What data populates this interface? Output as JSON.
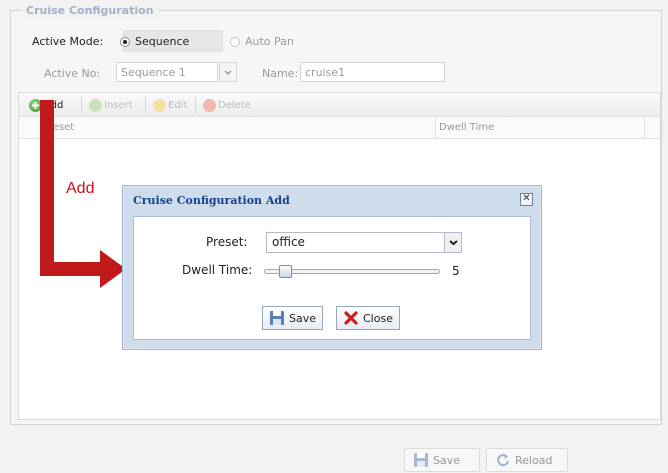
{
  "section": {
    "legend": "Cruise Configuration"
  },
  "mode": {
    "label": "Active Mode:",
    "options": [
      {
        "label": "Sequence",
        "selected": true
      },
      {
        "label": "Auto Pan",
        "selected": false
      }
    ]
  },
  "active": {
    "no_label": "Active No:",
    "no_value": "Sequence 1",
    "name_label": "Name:",
    "name_value": "cruise1"
  },
  "toolbar": {
    "add": "Add",
    "insert": "Insert",
    "edit": "Edit",
    "delete": "Delete"
  },
  "table": {
    "columns": [
      "Preset",
      "Dwell Time"
    ]
  },
  "callout": {
    "text": "Add"
  },
  "dialog": {
    "title": "Cruise Configuration Add",
    "close_symbol": "✕",
    "preset_label": "Preset:",
    "preset_value": "office",
    "dwell_label": "Dwell Time:",
    "dwell_value": "5",
    "dwell_fraction": 0.09,
    "save": "Save",
    "close": "Close"
  },
  "footer": {
    "save": "Save",
    "reload": "Reload"
  },
  "colors": {
    "accent_red": "#c01a1a",
    "dialog_title": "#15428b",
    "add_icon_green": "#4aa03a"
  },
  "icons": {
    "add": "plus-circle-icon",
    "insert": "insert-circle-icon",
    "edit": "edit-circle-icon",
    "delete": "delete-circle-icon",
    "save": "floppy-disk-icon",
    "close": "red-x-icon",
    "reload": "refresh-icon"
  }
}
